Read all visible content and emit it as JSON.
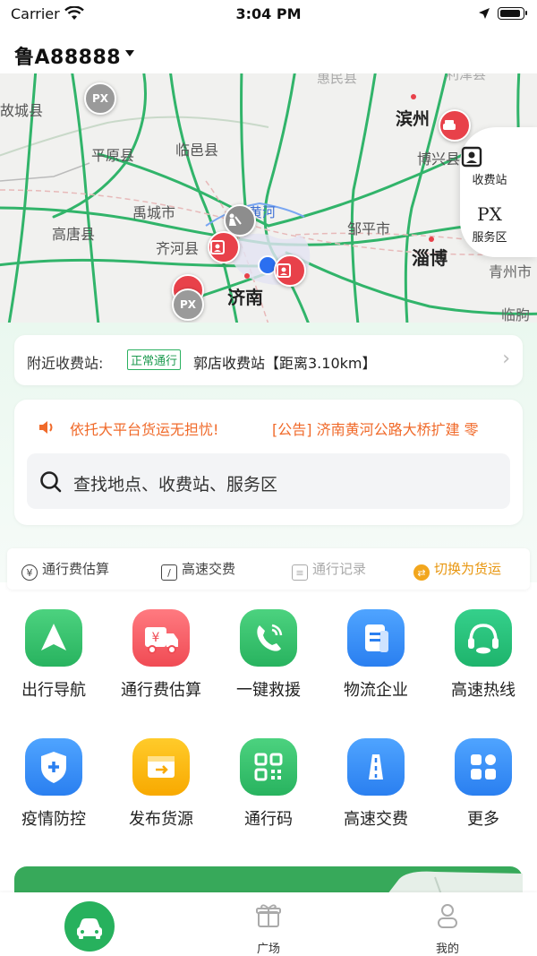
{
  "status_bar": {
    "carrier": "Carrier",
    "time": "3:04 PM"
  },
  "header": {
    "plate": "鲁A88888"
  },
  "map": {
    "cities": {
      "guchengxian": "故城县",
      "huiminxian": "惠民县",
      "lijinxian": "利津县",
      "pingyuanxian": "平原县",
      "linyixian": "临邑县",
      "binzhou": "滨州",
      "boxingxian": "博兴县",
      "yuchengshi": "禹城市",
      "gaotangxian": "高唐县",
      "qihexian": "齐河县",
      "zoupingshi": "邹平市",
      "zibo": "淄博",
      "jinan": "济南",
      "qingzhoushi": "青州市",
      "linqu": "临朐"
    },
    "river": "黄河",
    "side": {
      "toll_label": "收费站",
      "service_label": "服务区",
      "service_mark": "PX"
    },
    "pins": {
      "service_mark": "PX"
    }
  },
  "nearby": {
    "label": "附近收费站:",
    "badge": "正常通行",
    "station": "郭店收费站【距离3.10km】",
    "arrow": "›"
  },
  "notice": {
    "slogan": "依托大平台货运无担忧!",
    "announcement": "[公告] 济南黄河公路大桥扩建 零"
  },
  "search": {
    "placeholder": "查找地点、收费站、服务区"
  },
  "quick_bar": {
    "fee_estimate": "通行费估算",
    "highway_pay": "高速交费",
    "records": "通行记录",
    "switch": "切换为货运"
  },
  "grid": [
    {
      "label": "出行导航",
      "color": "#28b35f"
    },
    {
      "label": "通行费估算",
      "color": "#f04b54"
    },
    {
      "label": "一键救援",
      "color": "#28b35f"
    },
    {
      "label": "物流企业",
      "color": "#2a7ff0"
    },
    {
      "label": "高速热线",
      "color": "#28b35f"
    },
    {
      "label": "疫情防控",
      "color": "#2a7ff0"
    },
    {
      "label": "发布货源",
      "color": "#f8a900"
    },
    {
      "label": "通行码",
      "color": "#28b35f"
    },
    {
      "label": "高速交费",
      "color": "#2a7ff0"
    },
    {
      "label": "更多",
      "color": "#2a7ff0"
    }
  ],
  "tabbar": {
    "plaza": "广场",
    "mine": "我的"
  },
  "colors": {
    "brand_green": "#27b15d",
    "notice_orange": "#f06a2a",
    "switch_amber": "#e8960f"
  }
}
